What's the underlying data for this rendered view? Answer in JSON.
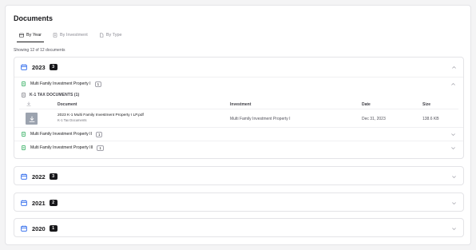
{
  "page": {
    "title": "Documents",
    "tabs": [
      "By Year",
      "By Investment",
      "By Type"
    ],
    "showing": "Showing 12 of 12 documents"
  },
  "years": [
    {
      "year": "2023",
      "count": "3",
      "expanded": true
    },
    {
      "year": "2022",
      "count": "3",
      "expanded": false
    },
    {
      "year": "2021",
      "count": "2",
      "expanded": false
    },
    {
      "year": "2020",
      "count": "1",
      "expanded": false
    }
  ],
  "y2023": {
    "properties": [
      {
        "name": "Multi Family Investment Property I",
        "count": "1"
      },
      {
        "name": "Multi Family Investment Property II",
        "count": "1"
      },
      {
        "name": "Multi Family Investment Property III",
        "count": "1"
      }
    ],
    "category": "K-1 TAX DOCUMENTS (1)",
    "table": {
      "headers": [
        "Document",
        "Investment",
        "Date",
        "Size"
      ],
      "row": {
        "file": "2023 K-1 Multi Family Investment Property I LP.pdf",
        "subtitle": "K-1 Tax Documents",
        "investment": "Multi Family Investment Property I",
        "date": "Dec 31, 2023",
        "size": "138.6 KB"
      }
    }
  },
  "colors": {
    "accent": "#2563eb",
    "doc_icon": "#16a34a",
    "badge": "#18181b"
  }
}
